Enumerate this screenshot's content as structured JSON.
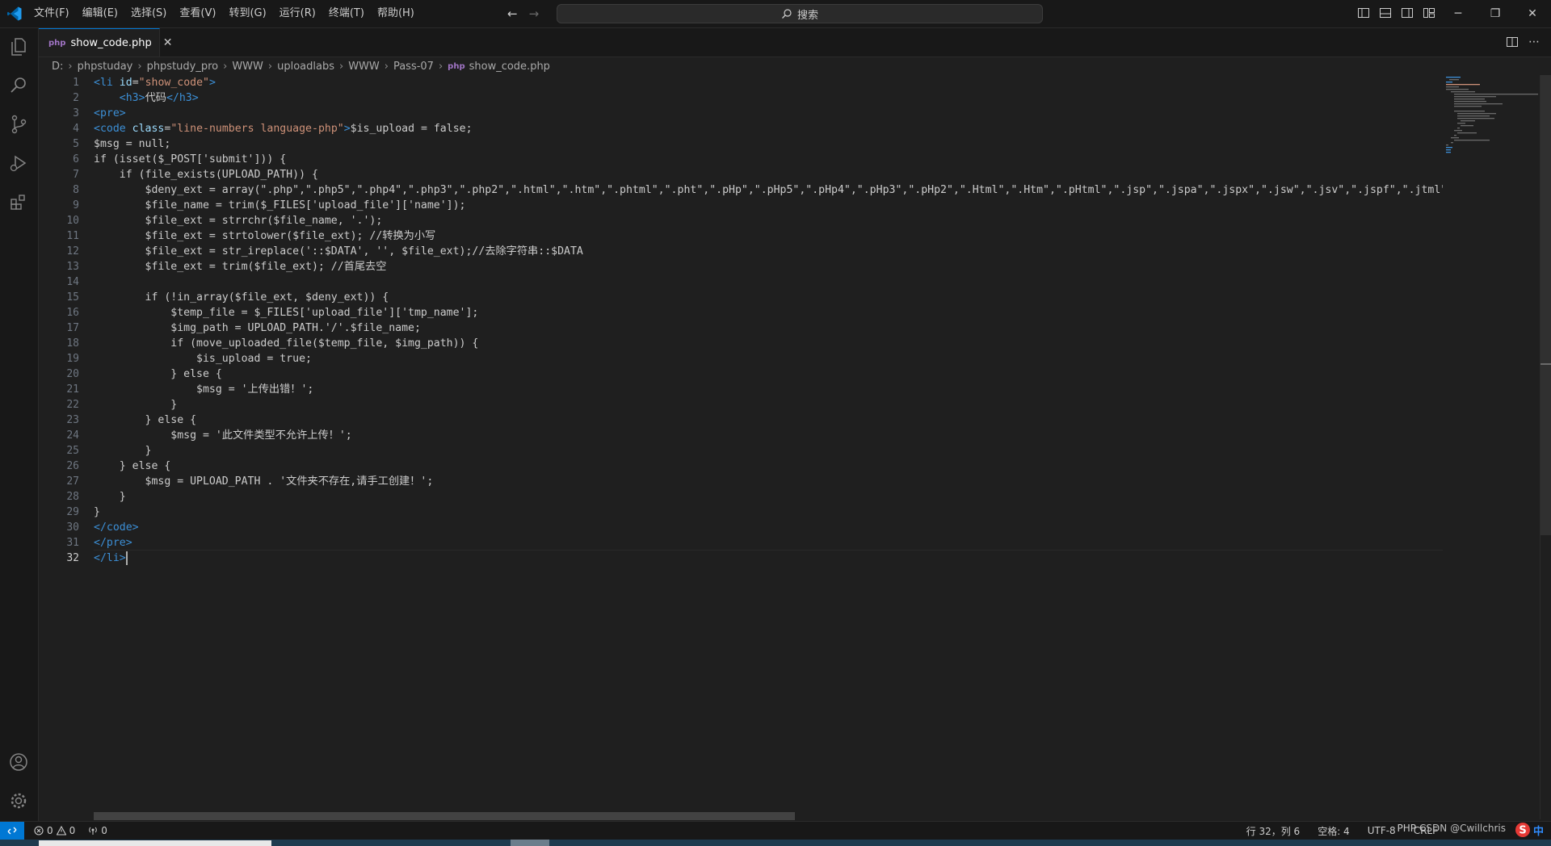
{
  "menu": [
    "文件(F)",
    "编辑(E)",
    "选择(S)",
    "查看(V)",
    "转到(G)",
    "运行(R)",
    "终端(T)",
    "帮助(H)"
  ],
  "search": {
    "label": "搜索"
  },
  "tab": {
    "name": "show_code.php"
  },
  "breadcrumb": [
    "D:",
    "phpstuday",
    "phpstudy_pro",
    "WWW",
    "uploadlabs",
    "WWW",
    "Pass-07",
    "show_code.php"
  ],
  "code": {
    "lines": [
      {
        "n": "1",
        "segs": [
          {
            "t": "<",
            "c": "tagc"
          },
          {
            "t": "li",
            "c": "tagc"
          },
          {
            "t": " "
          },
          {
            "t": "id",
            "c": "attr"
          },
          {
            "t": "="
          },
          {
            "t": "\"show_code\"",
            "c": "str"
          },
          {
            "t": ">",
            "c": "tagc"
          }
        ]
      },
      {
        "n": "2",
        "segs": [
          {
            "t": "    "
          },
          {
            "t": "<",
            "c": "tagc"
          },
          {
            "t": "h3",
            "c": "tagc"
          },
          {
            "t": ">",
            "c": "tagc"
          },
          {
            "t": "代码"
          },
          {
            "t": "</",
            "c": "tagc"
          },
          {
            "t": "h3",
            "c": "tagc"
          },
          {
            "t": ">",
            "c": "tagc"
          }
        ]
      },
      {
        "n": "3",
        "segs": [
          {
            "t": "<",
            "c": "tagc"
          },
          {
            "t": "pre",
            "c": "tagc"
          },
          {
            "t": ">",
            "c": "tagc"
          }
        ]
      },
      {
        "n": "4",
        "segs": [
          {
            "t": "<",
            "c": "tagc"
          },
          {
            "t": "code",
            "c": "tagc"
          },
          {
            "t": " "
          },
          {
            "t": "class",
            "c": "attr"
          },
          {
            "t": "="
          },
          {
            "t": "\"line-numbers language-php\"",
            "c": "str"
          },
          {
            "t": ">",
            "c": "tagc"
          },
          {
            "t": "$is_upload = false;"
          }
        ]
      },
      {
        "n": "5",
        "segs": [
          {
            "t": "$msg = null;"
          }
        ]
      },
      {
        "n": "6",
        "segs": [
          {
            "t": "if (isset($_POST['submit'])) {"
          }
        ]
      },
      {
        "n": "7",
        "segs": [
          {
            "t": "    if (file_exists(UPLOAD_PATH)) {"
          }
        ]
      },
      {
        "n": "8",
        "segs": [
          {
            "t": "        $deny_ext = array(\".php\",\".php5\",\".php4\",\".php3\",\".php2\",\".html\",\".htm\",\".phtml\",\".pht\",\".pHp\",\".pHp5\",\".pHp4\",\".pHp3\",\".pHp2\",\".Html\",\".Htm\",\".pHtml\",\".jsp\",\".jspa\",\".jspx\",\".jsw\",\".jsv\",\".jspf\",\".jtml\",\".jSp"
          }
        ]
      },
      {
        "n": "9",
        "segs": [
          {
            "t": "        $file_name = trim($_FILES['upload_file']['name']);"
          }
        ]
      },
      {
        "n": "10",
        "segs": [
          {
            "t": "        $file_ext = strrchr($file_name, '.');"
          }
        ]
      },
      {
        "n": "11",
        "segs": [
          {
            "t": "        $file_ext = strtolower($file_ext); //转换为小写"
          }
        ]
      },
      {
        "n": "12",
        "segs": [
          {
            "t": "        $file_ext = str_ireplace('::$DATA', '', $file_ext);//去除字符串::$DATA"
          }
        ]
      },
      {
        "n": "13",
        "segs": [
          {
            "t": "        $file_ext = trim($file_ext); //首尾去空"
          }
        ]
      },
      {
        "n": "14",
        "segs": [
          {
            "t": ""
          }
        ]
      },
      {
        "n": "15",
        "segs": [
          {
            "t": "        if (!in_array($file_ext, $deny_ext)) {"
          }
        ]
      },
      {
        "n": "16",
        "segs": [
          {
            "t": "            $temp_file = $_FILES['upload_file']['tmp_name'];"
          }
        ]
      },
      {
        "n": "17",
        "segs": [
          {
            "t": "            $img_path = UPLOAD_PATH.'/'.$file_name;"
          }
        ]
      },
      {
        "n": "18",
        "segs": [
          {
            "t": "            if (move_uploaded_file($temp_file, $img_path)) {"
          }
        ]
      },
      {
        "n": "19",
        "segs": [
          {
            "t": "                $is_upload = true;"
          }
        ]
      },
      {
        "n": "20",
        "segs": [
          {
            "t": "            } else {"
          }
        ]
      },
      {
        "n": "21",
        "segs": [
          {
            "t": "                $msg = '上传出错！';"
          }
        ]
      },
      {
        "n": "22",
        "segs": [
          {
            "t": "            }"
          }
        ]
      },
      {
        "n": "23",
        "segs": [
          {
            "t": "        } else {"
          }
        ]
      },
      {
        "n": "24",
        "segs": [
          {
            "t": "            $msg = '此文件类型不允许上传！';"
          }
        ]
      },
      {
        "n": "25",
        "segs": [
          {
            "t": "        }"
          }
        ]
      },
      {
        "n": "26",
        "segs": [
          {
            "t": "    } else {"
          }
        ]
      },
      {
        "n": "27",
        "segs": [
          {
            "t": "        $msg = UPLOAD_PATH . '文件夹不存在,请手工创建！';"
          }
        ]
      },
      {
        "n": "28",
        "segs": [
          {
            "t": "    }"
          }
        ]
      },
      {
        "n": "29",
        "segs": [
          {
            "t": "}"
          }
        ]
      },
      {
        "n": "30",
        "segs": [
          {
            "t": "</",
            "c": "tagc"
          },
          {
            "t": "code",
            "c": "tagc"
          },
          {
            "t": ">",
            "c": "tagc"
          }
        ]
      },
      {
        "n": "31",
        "segs": [
          {
            "t": "</",
            "c": "tagc"
          },
          {
            "t": "pre",
            "c": "tagc"
          },
          {
            "t": ">",
            "c": "tagc"
          }
        ]
      },
      {
        "n": "32",
        "segs": [
          {
            "t": "</",
            "c": "tagc"
          },
          {
            "t": "li",
            "c": "tagc"
          },
          {
            "t": ">",
            "c": "tagc"
          }
        ],
        "current": true
      }
    ]
  },
  "status": {
    "errors": "0",
    "warnings": "0",
    "ports": "0",
    "position": "行 32，列 6",
    "spaces": "空格: 4",
    "encoding": "UTF-8",
    "eol": "CRLF",
    "language": "PHP",
    "watermark": "CSDN @Cwillchris",
    "ime": "中"
  },
  "colors": {
    "accent": "#0078d4",
    "background": "#1f1f1f",
    "chrome": "#181818"
  }
}
